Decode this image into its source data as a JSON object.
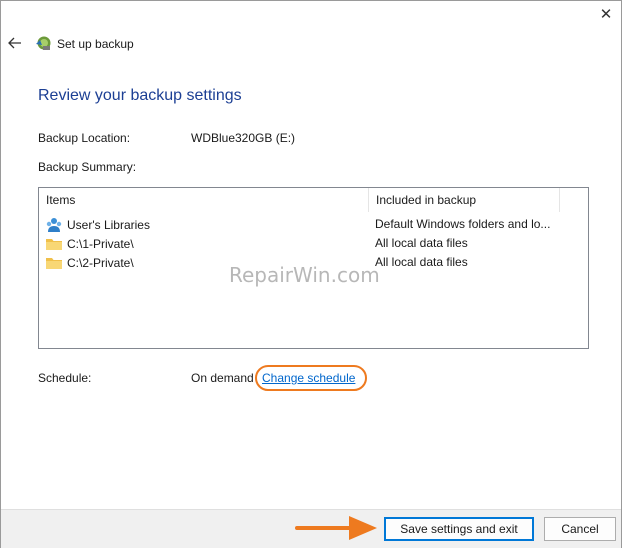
{
  "window": {
    "title": "Set up backup",
    "close_glyph": "✕"
  },
  "page": {
    "heading": "Review your backup settings",
    "backup_location_label": "Backup Location:",
    "backup_location_value": "WDBlue320GB (E:)",
    "backup_summary_label": "Backup Summary:",
    "schedule_label": "Schedule:",
    "schedule_value": "On demand",
    "change_schedule_link": "Change schedule"
  },
  "summary_table": {
    "columns": [
      "Items",
      "Included in backup"
    ],
    "rows": [
      {
        "icon": "users-libraries-icon",
        "name": "User's Libraries",
        "included": "Default Windows folders and lo..."
      },
      {
        "icon": "folder-icon",
        "name": "C:\\1-Private\\",
        "included": "All local data files"
      },
      {
        "icon": "folder-icon",
        "name": "C:\\2-Private\\",
        "included": "All local data files"
      }
    ]
  },
  "watermark": "RepairWin.com",
  "footer": {
    "save_button": "Save settings and exit",
    "cancel_button": "Cancel"
  },
  "colors": {
    "heading": "#1c3f94",
    "link": "#0066cc",
    "annotation_orange": "#ee7a1f",
    "primary_border": "#0078d7"
  }
}
